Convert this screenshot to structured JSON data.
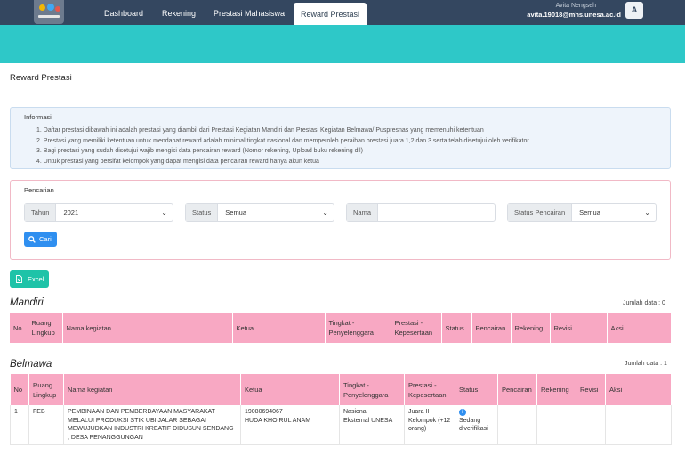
{
  "nav": {
    "items": [
      "Dashboard",
      "Rekening",
      "Prestasi Mahasiswa"
    ],
    "active": "Reward Prestasi"
  },
  "user": {
    "name": "Avita Nengseh",
    "email": "avita.19018@mhs.unesa.ac.id",
    "avatar_letter": "A"
  },
  "page": {
    "title": "Reward Prestasi"
  },
  "info": {
    "title": "Informasi",
    "items": [
      "1. Daftar prestasi dibawah ini adalah prestasi yang diambil dari Prestasi Kegiatan Mandiri dan Prestasi Kegiatan Belmawa/ Puspresnas yang memenuhi ketentuan",
      "2. Prestasi yang memiliki ketentuan untuk mendapat reward adalah minimal tingkat nasional dan memperoleh peraihan prestasi juara 1,2 dan 3 serta telah disetujui oleh verifikator",
      "3. Bagi prestasi yang sudah disetujui wajib mengisi data pencairan reward (Nomor rekening, Upload buku rekening dll)",
      "4. Untuk prestasi yang bersifat kelompok yang dapat mengisi data pencairan reward hanya akun ketua"
    ]
  },
  "search": {
    "title": "Pencarian",
    "tahun": {
      "label": "Tahun",
      "value": "2021"
    },
    "status": {
      "label": "Status",
      "value": "Semua"
    },
    "nama": {
      "label": "Nama",
      "value": ""
    },
    "status_pencairan": {
      "label": "Status Pencairan",
      "value": "Semua"
    },
    "button": "Cari"
  },
  "excel_button": "Excel",
  "mandiri": {
    "title": "Mandiri",
    "count": "Jumlah data : 0",
    "headers": [
      "No",
      "Ruang Lingkup",
      "Nama kegiatan",
      "Ketua",
      "Tingkat - Penyelenggara",
      "Prestasi - Kepesertaan",
      "Status",
      "Pencairan",
      "Rekening",
      "Revisi",
      "Aksi"
    ]
  },
  "belmawa": {
    "title": "Belmawa",
    "count": "Jumlah data : 1",
    "headers": [
      "No",
      "Ruang Lingkup",
      "Nama kegiatan",
      "Ketua",
      "Tingkat - Penyelenggara",
      "Prestasi - Kepesertaan",
      "Status",
      "Pencairan",
      "Rekening",
      "Revisi",
      "Aksi"
    ],
    "rows": [
      {
        "no": "1",
        "ruang_lingkup": "FEB",
        "nama_kegiatan": "PEMBINAAN DAN PEMBERDAYAAN MASYARAKAT MELALUI PRODUKSI STIK UBI JALAR SEBAGAI MEWUJUDKAN INDUSTRI KREATIF DIDUSUN SENDANG , DESA PENANGGUNGAN",
        "ketua_nim": "19080694067",
        "ketua_nama": "HUDA KHOIRUL ANAM",
        "tingkat": "Nasional",
        "penyelenggara": "Eksternal UNESA",
        "prestasi": "Juara II",
        "kepesertaan": "Kelompok (+12 orang)",
        "status": "Sedang diverifikasi"
      }
    ]
  },
  "colors": {
    "nav_bg": "#344760",
    "band": "#2ec8c8",
    "table_header": "#f8a8c3",
    "primary": "#2f8ff0",
    "excel": "#1ec3a8"
  }
}
